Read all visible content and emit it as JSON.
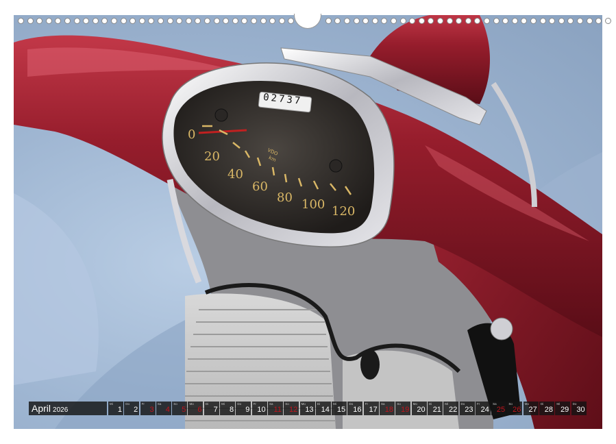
{
  "calendar": {
    "month": "April",
    "year": "2026",
    "days": [
      {
        "wd": "Mi",
        "d": "1",
        "red": false
      },
      {
        "wd": "Do",
        "d": "2",
        "red": false
      },
      {
        "wd": "Fr",
        "d": "3",
        "red": true
      },
      {
        "wd": "Sa",
        "d": "4",
        "red": true
      },
      {
        "wd": "So",
        "d": "5",
        "red": true
      },
      {
        "wd": "Mo",
        "d": "6",
        "red": true
      },
      {
        "wd": "Di",
        "d": "7",
        "red": false
      },
      {
        "wd": "Mi",
        "d": "8",
        "red": false
      },
      {
        "wd": "Do",
        "d": "9",
        "red": false
      },
      {
        "wd": "Fr",
        "d": "10",
        "red": false
      },
      {
        "wd": "Sa",
        "d": "11",
        "red": true
      },
      {
        "wd": "So",
        "d": "12",
        "red": true
      },
      {
        "wd": "Mo",
        "d": "13",
        "red": false
      },
      {
        "wd": "Di",
        "d": "14",
        "red": false
      },
      {
        "wd": "Mi",
        "d": "15",
        "red": false
      },
      {
        "wd": "Do",
        "d": "16",
        "red": false
      },
      {
        "wd": "Fr",
        "d": "17",
        "red": false
      },
      {
        "wd": "Sa",
        "d": "18",
        "red": true
      },
      {
        "wd": "So",
        "d": "19",
        "red": true
      },
      {
        "wd": "Mo",
        "d": "20",
        "red": false
      },
      {
        "wd": "Di",
        "d": "21",
        "red": false
      },
      {
        "wd": "Mi",
        "d": "22",
        "red": false
      },
      {
        "wd": "Do",
        "d": "23",
        "red": false
      },
      {
        "wd": "Fr",
        "d": "24",
        "red": false
      },
      {
        "wd": "Sa",
        "d": "25",
        "red": true
      },
      {
        "wd": "So",
        "d": "26",
        "red": true
      },
      {
        "wd": "Mo",
        "d": "27",
        "red": false
      },
      {
        "wd": "Di",
        "d": "28",
        "red": false
      },
      {
        "wd": "Mi",
        "d": "29",
        "red": false
      },
      {
        "wd": "Do",
        "d": "30",
        "red": false
      }
    ]
  },
  "speedometer": {
    "odometer": "02737",
    "brand": "VDO",
    "unit": "km",
    "scale": [
      "0",
      "20",
      "40",
      "60",
      "80",
      "100",
      "120"
    ]
  },
  "colors": {
    "paint": "#8e1a28",
    "chrome": "#d8d8dc",
    "cloth": "#a9bfdb",
    "dial_numbers": "#d9b766",
    "holiday": "#c0141c"
  }
}
